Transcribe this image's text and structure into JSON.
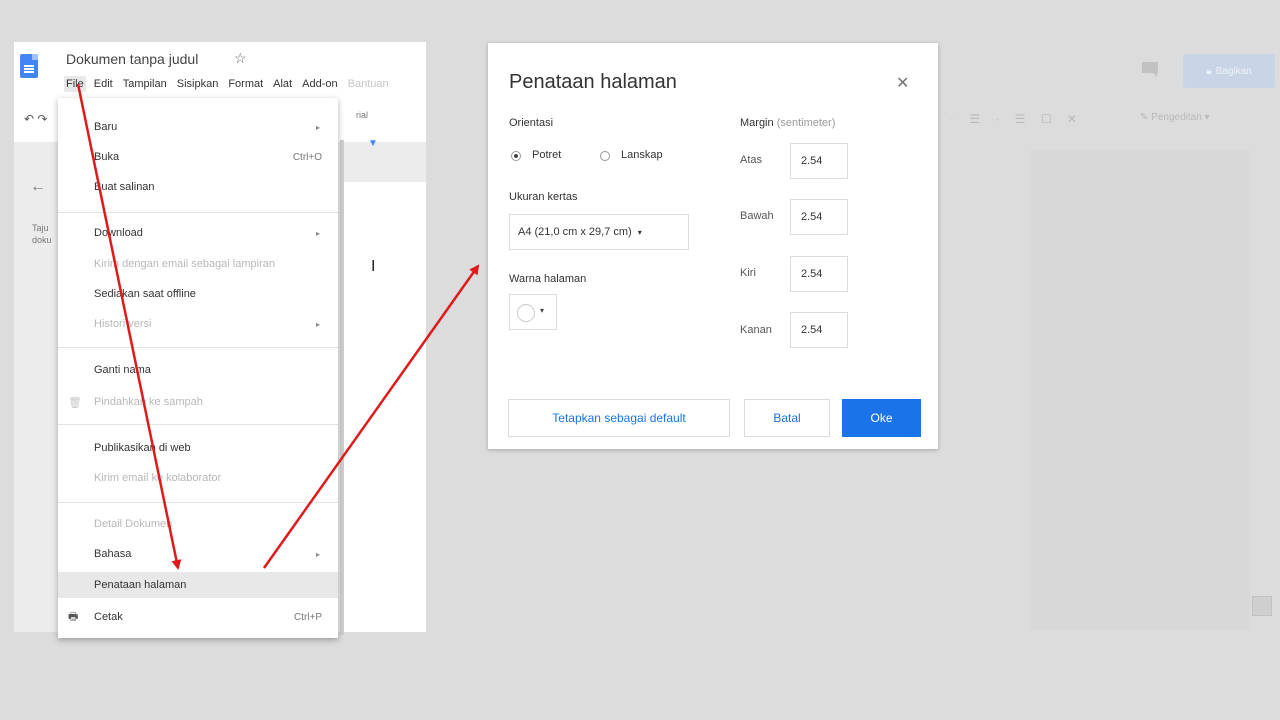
{
  "bg_app": {
    "share_label": "Bagikan",
    "edit_mode_label": "Pengeditan"
  },
  "left_doc": {
    "title": "Dokumen tanpa judul",
    "menubar": [
      "File",
      "Edit",
      "Tampilan",
      "Sisipkan",
      "Format",
      "Alat",
      "Add-on",
      "Bantuan"
    ],
    "font_label": "rial",
    "outline_label_1": "Taju",
    "outline_label_2": "doku",
    "cursor_glyph": "I"
  },
  "file_menu": {
    "items": [
      {
        "label": "Baru",
        "shortcut": "",
        "submenu": true,
        "disabled": false
      },
      {
        "label": "Buka",
        "shortcut": "Ctrl+O",
        "submenu": false,
        "disabled": false
      },
      {
        "label": "Buat salinan",
        "shortcut": "",
        "submenu": false,
        "disabled": false
      },
      {
        "label": "Download",
        "shortcut": "",
        "submenu": true,
        "disabled": false
      },
      {
        "label": "Kirim dengan email sebagai lampiran",
        "shortcut": "",
        "submenu": false,
        "disabled": true
      },
      {
        "label": "Sediakan saat offline",
        "shortcut": "",
        "submenu": false,
        "disabled": false
      },
      {
        "label": "Histori versi",
        "shortcut": "",
        "submenu": true,
        "disabled": true
      },
      {
        "label": "Ganti nama",
        "shortcut": "",
        "submenu": false,
        "disabled": false
      },
      {
        "label": "Pindahkan ke sampah",
        "shortcut": "",
        "submenu": false,
        "disabled": true
      },
      {
        "label": "Publikasikan di web",
        "shortcut": "",
        "submenu": false,
        "disabled": false
      },
      {
        "label": "Kirim email ke kolaborator",
        "shortcut": "",
        "submenu": false,
        "disabled": true
      },
      {
        "label": "Detail Dokumen",
        "shortcut": "",
        "submenu": false,
        "disabled": true
      },
      {
        "label": "Bahasa",
        "shortcut": "",
        "submenu": true,
        "disabled": false
      },
      {
        "label": "Penataan halaman",
        "shortcut": "",
        "submenu": false,
        "disabled": false,
        "highlighted": true
      },
      {
        "label": "Cetak",
        "shortcut": "Ctrl+P",
        "submenu": false,
        "disabled": false
      }
    ]
  },
  "dialog": {
    "title": "Penataan halaman",
    "orientation_label": "Orientasi",
    "portrait_label": "Potret",
    "landscape_label": "Lanskap",
    "orientation_selected": "Potret",
    "paper_size_label": "Ukuran kertas",
    "paper_size_value": "A4 (21,0 cm x 29,7 cm)",
    "page_color_label": "Warna halaman",
    "margin_label": "Margin",
    "margin_unit": "(sentimeter)",
    "margins": {
      "top_label": "Atas",
      "top_value": "2.54",
      "bottom_label": "Bawah",
      "bottom_value": "2.54",
      "left_label": "Kiri",
      "left_value": "2.54",
      "right_label": "Kanan",
      "right_value": "2.54"
    },
    "default_button": "Tetapkan sebagai default",
    "cancel_button": "Batal",
    "ok_button": "Oke"
  },
  "colors": {
    "accent": "#1a73e8",
    "annotation_arrow": "#e01a1a",
    "docs_blue": "#4285f4"
  }
}
